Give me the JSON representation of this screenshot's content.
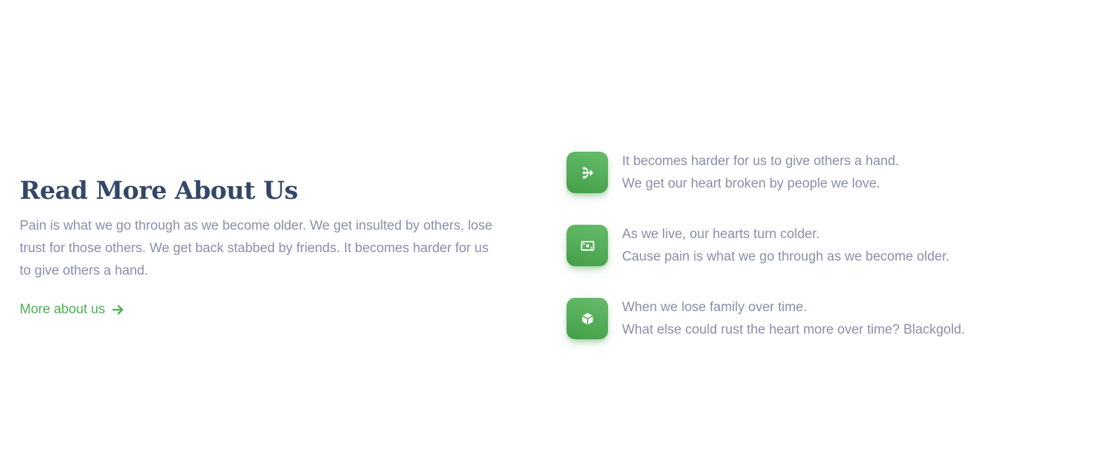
{
  "about": {
    "title": "Read More About Us",
    "description": "Pain is what we go through as we become older. We get insulted by others, lose trust for those others. We get back stabbed by friends. It becomes harder for us to give others a hand.",
    "link_label": "More about us",
    "link_icon": "arrow-right-icon",
    "accent_color": "#4caf50",
    "title_color": "#344767",
    "text_color": "#8a8fa8"
  },
  "features": [
    {
      "icon": "flow-share-icon",
      "line1": "It becomes harder for us to give others a hand.",
      "line2": "We get our heart broken by people we love."
    },
    {
      "icon": "payments-icon",
      "line1": "As we live, our hearts turn colder.",
      "line2": "Cause pain is what we go through as we become older."
    },
    {
      "icon": "cube-icon",
      "line1": "When we lose family over time.",
      "line2": "What else could rust the heart more over time? Blackgold."
    }
  ]
}
